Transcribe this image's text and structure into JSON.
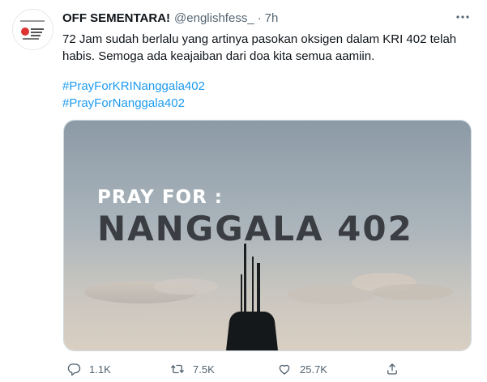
{
  "tweet": {
    "author_name": "OFF SEMENTARA!",
    "author_handle": "@englishfess_",
    "separator": "·",
    "time": "7h",
    "text": "72 Jam sudah berlalu yang artinya pasokan oksigen dalam KRI 402 telah habis. Semoga ada keajaiban dari doa kita semua aamiin.",
    "hashtags": [
      "#PrayForKRINanggala402",
      "#PrayForNanggala402"
    ],
    "media": {
      "line1": "PRAY FOR :",
      "line2": "NANGGALA 402"
    },
    "actions": {
      "reply_count": "1.1K",
      "retweet_count": "7.5K",
      "like_count": "25.7K"
    }
  },
  "icons": [
    "avatar-logo",
    "more-icon",
    "reply-icon",
    "retweet-icon",
    "like-icon",
    "share-icon"
  ],
  "colors": {
    "link": "#1d9bf0",
    "muted": "#536471",
    "text": "#0f1419"
  }
}
